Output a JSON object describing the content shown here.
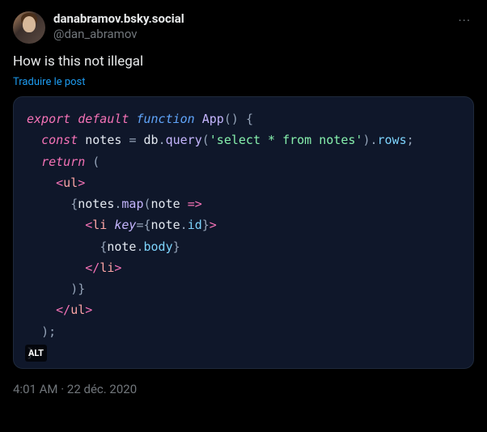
{
  "header": {
    "display_name": "danabramov.bsky.social",
    "handle": "@dan_abramov",
    "more_glyph": "···"
  },
  "post": {
    "text": "How is this not illegal",
    "translate_label": "Traduire le post",
    "alt_badge": "ALT"
  },
  "code": {
    "tokens": {
      "export": "export",
      "default": "default",
      "function": "function",
      "app": "App",
      "parens_open_close": "()",
      "brace_open": "{",
      "const": "const",
      "notes": "notes",
      "equals": "=",
      "db": "db",
      "dot": ".",
      "query": "query",
      "paren_open": "(",
      "query_str": "'select * from notes'",
      "paren_close": ")",
      "rows": "rows",
      "semi": ";",
      "return": "return",
      "ul_open": "<ul>",
      "notes_map_open": "{",
      "map": "map",
      "note_param": "note",
      "arrow": "=>",
      "lt": "<",
      "li": "li",
      "key": "key",
      "eq": "=",
      "note": "note",
      "id": "id",
      "gt": ">",
      "body": "body",
      "li_close": "</li>",
      "map_close": ")}",
      "ul_close": "</ul>",
      "ret_close": ");",
      "brace_close": "}"
    }
  },
  "timestamp": {
    "time": "4:01 AM",
    "sep": " · ",
    "date": "22 déc. 2020"
  }
}
